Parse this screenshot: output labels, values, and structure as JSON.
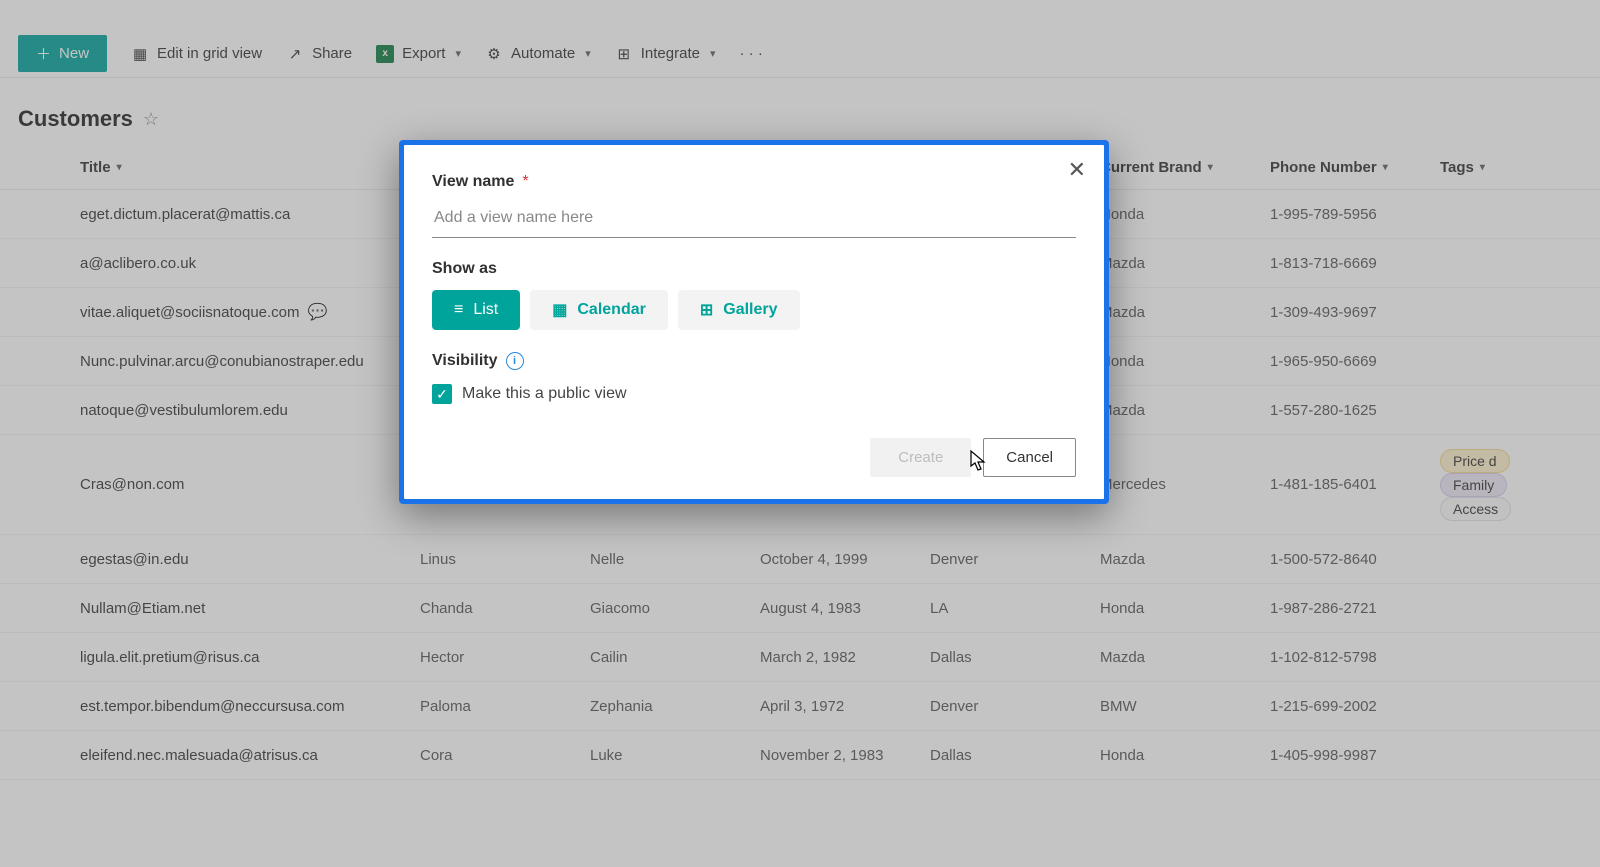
{
  "commandBar": {
    "new": "New",
    "editGrid": "Edit in grid view",
    "share": "Share",
    "export": "Export",
    "automate": "Automate",
    "integrate": "Integrate"
  },
  "page": {
    "title": "Customers"
  },
  "columns": {
    "title": "Title",
    "firstName": "",
    "lastName": "",
    "birthdate": "",
    "location": "",
    "brand": "Current Brand",
    "phone": "Phone Number",
    "tags": "Tags"
  },
  "rows": [
    {
      "title": "eget.dictum.placerat@mattis.ca",
      "first": "",
      "last": "",
      "dob": "",
      "loc": "",
      "brand": "Honda",
      "phone": "1-995-789-5956",
      "comments": false
    },
    {
      "title": "a@aclibero.co.uk",
      "first": "",
      "last": "",
      "dob": "",
      "loc": "",
      "brand": "Mazda",
      "phone": "1-813-718-6669",
      "comments": false
    },
    {
      "title": "vitae.aliquet@sociisnatoque.com",
      "first": "",
      "last": "",
      "dob": "",
      "loc": "",
      "brand": "Mazda",
      "phone": "1-309-493-9697",
      "comments": true
    },
    {
      "title": "Nunc.pulvinar.arcu@conubianostraper.edu",
      "first": "",
      "last": "",
      "dob": "",
      "loc": "",
      "brand": "Honda",
      "phone": "1-965-950-6669",
      "comments": false
    },
    {
      "title": "natoque@vestibulumlorem.edu",
      "first": "",
      "last": "",
      "dob": "",
      "loc": "",
      "brand": "Mazda",
      "phone": "1-557-280-1625",
      "comments": false
    },
    {
      "title": "Cras@non.com",
      "first": "",
      "last": "",
      "dob": "",
      "loc": "",
      "brand": "Mercedes",
      "phone": "1-481-185-6401",
      "comments": false
    },
    {
      "title": "egestas@in.edu",
      "first": "Linus",
      "last": "Nelle",
      "dob": "October 4, 1999",
      "loc": "Denver",
      "brand": "Mazda",
      "phone": "1-500-572-8640",
      "comments": false
    },
    {
      "title": "Nullam@Etiam.net",
      "first": "Chanda",
      "last": "Giacomo",
      "dob": "August 4, 1983",
      "loc": "LA",
      "brand": "Honda",
      "phone": "1-987-286-2721",
      "comments": false
    },
    {
      "title": "ligula.elit.pretium@risus.ca",
      "first": "Hector",
      "last": "Cailin",
      "dob": "March 2, 1982",
      "loc": "Dallas",
      "brand": "Mazda",
      "phone": "1-102-812-5798",
      "comments": false
    },
    {
      "title": "est.tempor.bibendum@neccursusa.com",
      "first": "Paloma",
      "last": "Zephania",
      "dob": "April 3, 1972",
      "loc": "Denver",
      "brand": "BMW",
      "phone": "1-215-699-2002",
      "comments": false
    },
    {
      "title": "eleifend.nec.malesuada@atrisus.ca",
      "first": "Cora",
      "last": "Luke",
      "dob": "November 2, 1983",
      "loc": "Dallas",
      "brand": "Honda",
      "phone": "1-405-998-9987",
      "comments": false
    }
  ],
  "tagPills": {
    "price": "Price d",
    "family": "Family",
    "access": "Access"
  },
  "modal": {
    "viewNameLabel": "View name",
    "viewNamePlaceholder": "Add a view name here",
    "showAsLabel": "Show as",
    "optionList": "List",
    "optionCalendar": "Calendar",
    "optionGallery": "Gallery",
    "visibilityLabel": "Visibility",
    "publicLabel": "Make this a public view",
    "create": "Create",
    "cancel": "Cancel"
  }
}
